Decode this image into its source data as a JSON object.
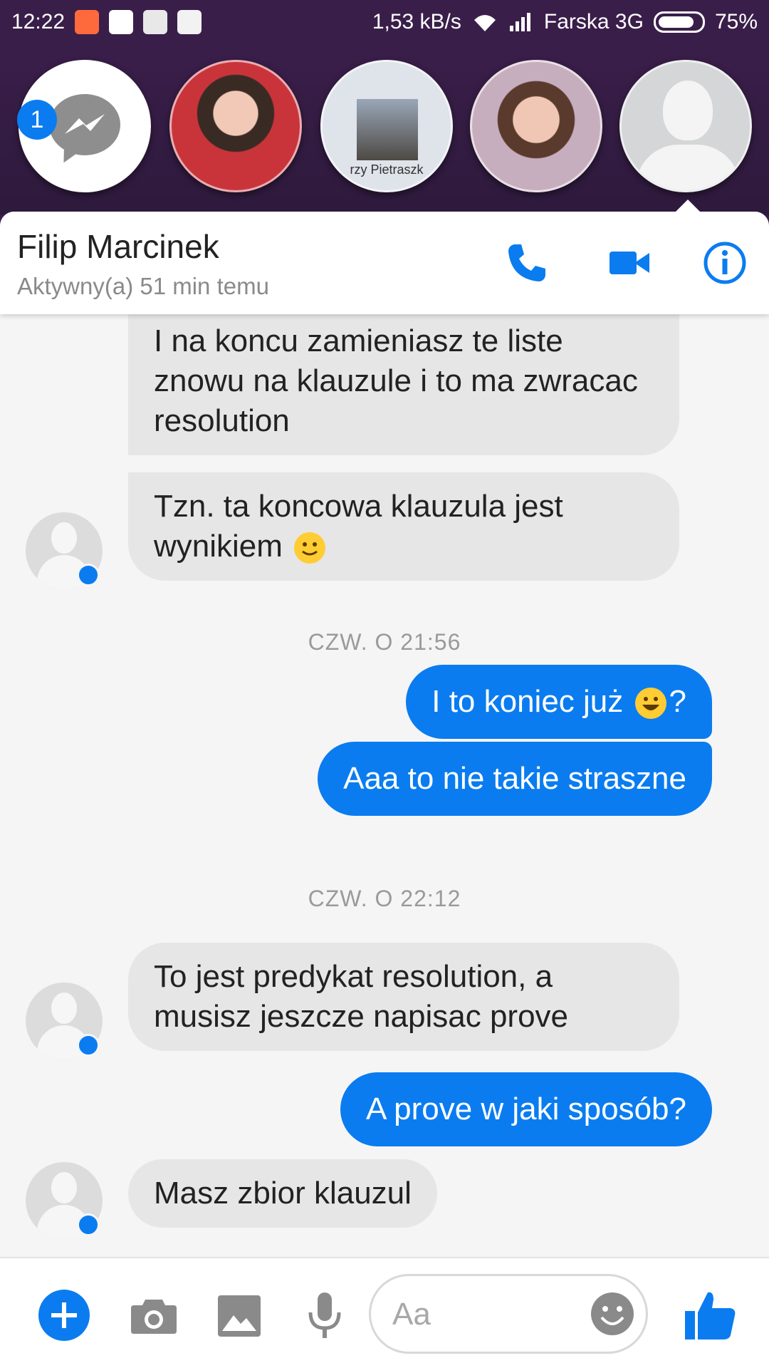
{
  "status_bar": {
    "time": "12:22",
    "net_speed": "1,53 kB/s",
    "carrier": "Farska 3G",
    "battery": "75%",
    "battery_level": 0.75
  },
  "chat_heads": {
    "badge_count": "1",
    "items": [
      {
        "name": "messenger-chathead"
      },
      {
        "name": "contact-chathead-2"
      },
      {
        "name": "contact-chathead-3",
        "caption": "rzy Pietraszk"
      },
      {
        "name": "contact-chathead-4"
      },
      {
        "name": "contact-chathead-5"
      }
    ]
  },
  "header": {
    "contact_name": "Filip Marcinek",
    "active_status": "Aktywny(a) 51 min temu"
  },
  "messages": [
    {
      "direction": "in",
      "text": "I na koncu zamieniasz te liste znowu na klauzule i to ma zwracac resolution"
    },
    {
      "direction": "in",
      "text_before": "Tzn. ta koncowa klauzula jest wynikiem",
      "emoji": "slightly-smiling-face"
    },
    {
      "timestamp": "CZW. O 21:56"
    },
    {
      "direction": "out",
      "text_before": "I to koniec już",
      "emoji": "grinning-face",
      "text_after": "?"
    },
    {
      "direction": "out",
      "text": "Aaa to nie takie straszne"
    },
    {
      "timestamp": "CZW. O 22:12"
    },
    {
      "direction": "in",
      "text": "To jest predykat resolution, a musisz jeszcze napisac prove"
    },
    {
      "direction": "out",
      "text": "A prove w jaki sposób?"
    },
    {
      "direction": "in",
      "text": "Masz zbior klauzul"
    }
  ],
  "composer": {
    "placeholder": "Aa",
    "icons": [
      "plus-icon",
      "camera-icon",
      "gallery-icon",
      "mic-icon",
      "emoji-icon",
      "like-icon"
    ]
  },
  "colors": {
    "accent": "#0a7cf0",
    "incoming_bubble": "#e6e6e6",
    "background": "#f5f5f5",
    "status_bar": "#3a1e4a"
  }
}
